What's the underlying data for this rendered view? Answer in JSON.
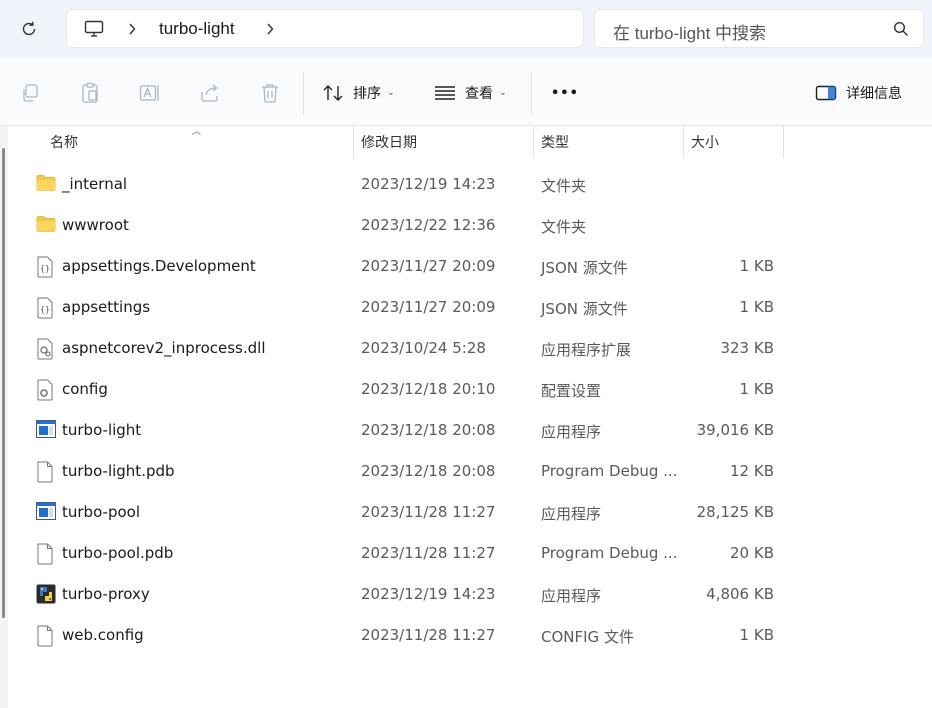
{
  "address_bar": {
    "breadcrumb": "turbo-light",
    "search_placeholder": "在 turbo-light 中搜索"
  },
  "toolbar": {
    "sort_label": "排序",
    "view_label": "查看",
    "more_label": "•••",
    "details_label": "详细信息"
  },
  "columns": {
    "name": "名称",
    "date": "修改日期",
    "type": "类型",
    "size": "大小"
  },
  "files": [
    {
      "name": "_internal",
      "date": "2023/12/19 14:23",
      "type": "文件夹",
      "size": "",
      "icon": "folder-icon"
    },
    {
      "name": "wwwroot",
      "date": "2023/12/22 12:36",
      "type": "文件夹",
      "size": "",
      "icon": "folder-icon"
    },
    {
      "name": "appsettings.Development",
      "date": "2023/11/27 20:09",
      "type": "JSON 源文件",
      "size": "1 KB",
      "icon": "json-file-icon"
    },
    {
      "name": "appsettings",
      "date": "2023/11/27 20:09",
      "type": "JSON 源文件",
      "size": "1 KB",
      "icon": "json-file-icon"
    },
    {
      "name": "aspnetcorev2_inprocess.dll",
      "date": "2023/10/24 5:28",
      "type": "应用程序扩展",
      "size": "323 KB",
      "icon": "dll-file-icon"
    },
    {
      "name": "config",
      "date": "2023/12/18 20:10",
      "type": "配置设置",
      "size": "1 KB",
      "icon": "config-file-icon"
    },
    {
      "name": "turbo-light",
      "date": "2023/12/18 20:08",
      "type": "应用程序",
      "size": "39,016 KB",
      "icon": "exe-icon"
    },
    {
      "name": "turbo-light.pdb",
      "date": "2023/12/18 20:08",
      "type": "Program Debug ...",
      "size": "12 KB",
      "icon": "file-icon"
    },
    {
      "name": "turbo-pool",
      "date": "2023/11/28 11:27",
      "type": "应用程序",
      "size": "28,125 KB",
      "icon": "exe-icon"
    },
    {
      "name": "turbo-pool.pdb",
      "date": "2023/11/28 11:27",
      "type": "Program Debug ...",
      "size": "20 KB",
      "icon": "file-icon"
    },
    {
      "name": "turbo-proxy",
      "date": "2023/12/19 14:23",
      "type": "应用程序",
      "size": "4,806 KB",
      "icon": "python-exe-icon"
    },
    {
      "name": "web.config",
      "date": "2023/11/28 11:27",
      "type": "CONFIG 文件",
      "size": "1 KB",
      "icon": "file-icon"
    }
  ],
  "colors": {
    "folder": "#f7c948",
    "exe_blue": "#1f6fd1",
    "accent_bg": "#f1f5fb"
  }
}
